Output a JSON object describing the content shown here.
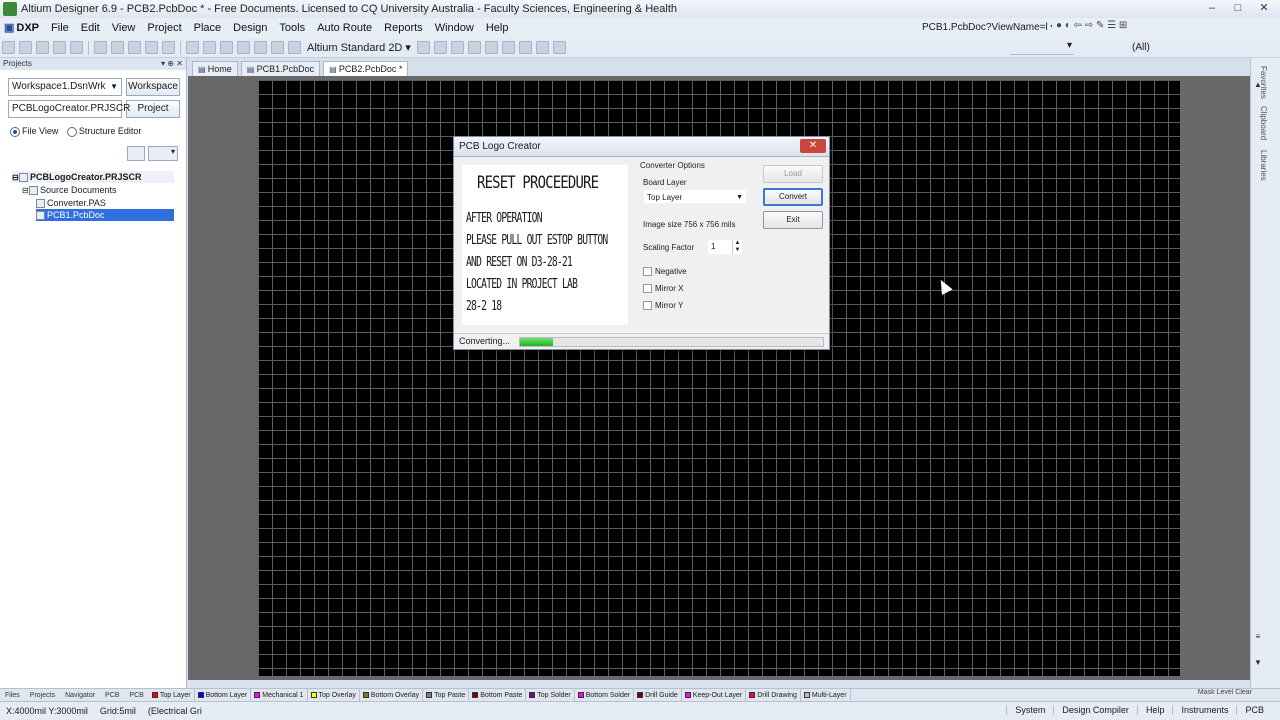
{
  "window": {
    "title": "Altium Designer 6.9 - PCB2.PcbDoc * - Free Documents. Licensed to CQ University Australia - Faculty Sciences, Engineering & Health",
    "controls": [
      "–",
      "□",
      "✕"
    ]
  },
  "menu": {
    "items": [
      "DXP",
      "File",
      "Edit",
      "View",
      "Project",
      "Place",
      "Design",
      "Tools",
      "Auto Route",
      "Reports",
      "Window",
      "Help"
    ],
    "right_combo": "PCB1.PcbDoc?ViewName=l ▾"
  },
  "toolbar": {
    "view_select": "Altium Standard 2D ▾",
    "filter_all": "(All)"
  },
  "left_panel": {
    "header": "Projects",
    "workspace_value": "Workspace1.DsnWrk",
    "workspace_button": "Workspace",
    "project_value": "PCBLogoCreator.PRJSCR",
    "project_button": "Project",
    "file_view": "File View",
    "structure_editor": "Structure Editor",
    "tree": {
      "project": "PCBLogoCreator.PRJSCR",
      "source_documents": "Source Documents",
      "converter": "Converter.PAS",
      "pcb": "PCB1.PcbDoc"
    }
  },
  "doc_tabs": [
    "Home",
    "PCB1.PcbDoc",
    "PCB2.PcbDoc *"
  ],
  "right_panel": {
    "tabs": [
      "Favorites",
      "Clipboard",
      "Libraries"
    ]
  },
  "dialog": {
    "title": "PCB Logo Creator",
    "close": "✕",
    "preview": {
      "title": "RESET PROCEEDURE",
      "lines": [
        "AFTER OPERATION",
        "PLEASE PULL OUT ESTOP BUTTON",
        "AND RESET ON D3-28-21",
        "LOCATED IN PROJECT LAB",
        "28-2 18"
      ]
    },
    "converter_options": "Converter Options",
    "board_layer_label": "Board Layer",
    "board_layer_value": "Top Layer",
    "image_size": "Image size  756 x 756 mils",
    "scaling_factor_label": "Scaling Factor",
    "scaling_factor_value": "1",
    "negative": "Negative",
    "mirror_x": "Mirror X",
    "mirror_y": "Mirror Y",
    "load": "Load",
    "convert": "Convert",
    "exit": "Exit",
    "status": "Converting...",
    "progress": 0.11
  },
  "layer_bar": {
    "panel_tabs": [
      "Files",
      "Projects",
      "Navigator",
      "PCB",
      "PCB"
    ],
    "layers": [
      {
        "name": "Top Layer",
        "color": "#ff0000"
      },
      {
        "name": "Bottom Layer",
        "color": "#0000ff"
      },
      {
        "name": "Mechanical 1",
        "color": "#ff00ff"
      },
      {
        "name": "Top Overlay",
        "color": "#ffff00"
      },
      {
        "name": "Bottom Overlay",
        "color": "#808000"
      },
      {
        "name": "Top Paste",
        "color": "#808080"
      },
      {
        "name": "Bottom Paste",
        "color": "#800000"
      },
      {
        "name": "Top Solder",
        "color": "#800080"
      },
      {
        "name": "Bottom Solder",
        "color": "#ff00ff"
      },
      {
        "name": "Drill Guide",
        "color": "#800000"
      },
      {
        "name": "Keep-Out Layer",
        "color": "#ff00ff"
      },
      {
        "name": "Drill Drawing",
        "color": "#ff002a"
      },
      {
        "name": "Multi-Layer",
        "color": "#c0c0c0"
      }
    ],
    "right": "Mask Level  Clear"
  },
  "status_bar": {
    "coords": "X:4000mil Y:3000mil",
    "grid": "Grid:5mil",
    "electrical": "(Electrical Gri",
    "right_items": [
      "System",
      "Design Compiler",
      "Help",
      "Instruments",
      "PCB"
    ]
  }
}
